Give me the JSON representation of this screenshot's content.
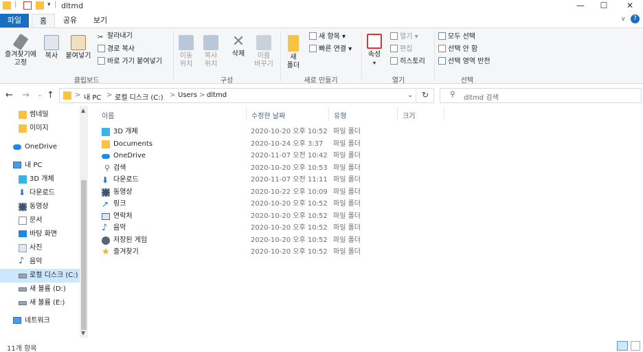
{
  "window": {
    "title": "dltmd",
    "minimize_glyph": "—",
    "maximize_glyph": "☐",
    "close_glyph": "✕"
  },
  "tabs": {
    "file": "파일",
    "home": "홈",
    "share": "공유",
    "view": "보기",
    "help_glyph": "?",
    "collapse_glyph": "∨"
  },
  "ribbon": {
    "pin": "즐겨찾기에\n고정",
    "copy": "복사",
    "paste": "붙여넣기",
    "cut": "잘라내기",
    "copy_path": "경로 복사",
    "paste_shortcut": "바로 가기 붙여넣기",
    "clipboard_group": "클립보드",
    "move_to": "이동\n위치",
    "copy_to": "복사\n위치",
    "delete": "삭제",
    "rename": "이름\n바꾸기",
    "organize_group": "구성",
    "new_folder": "새\n폴더",
    "new_item": "새 항목",
    "easy_access": "빠른 연결",
    "new_group": "새로 만들기",
    "properties": "속성",
    "open": "열기",
    "edit": "편집",
    "history": "히스토리",
    "open_group": "열기",
    "select_all": "모두 선택",
    "select_none": "선택 안 함",
    "invert_selection": "선택 영역 반전",
    "select_group": "선택"
  },
  "address": {
    "back": "←",
    "forward": "→",
    "recent": "⌄",
    "up": "↑",
    "crumbs": [
      "내 PC",
      "로컬 디스크 (C:)",
      "Users",
      "dltmd"
    ],
    "separator": ">",
    "dropdown": "⌄",
    "refresh": "↻",
    "search_placeholder": "dltmd 검색"
  },
  "sidebar": {
    "items": [
      {
        "label": "썸네일",
        "icon": "folder-icon"
      },
      {
        "label": "이미지",
        "icon": "folder-icon"
      },
      {
        "label": "OneDrive",
        "icon": "cloud-icon"
      },
      {
        "label": "내 PC",
        "icon": "pc-icon"
      },
      {
        "label": "3D 개체",
        "icon": "cube-icon"
      },
      {
        "label": "다운로드",
        "icon": "download-icon"
      },
      {
        "label": "동영상",
        "icon": "video-icon"
      },
      {
        "label": "문서",
        "icon": "document-icon"
      },
      {
        "label": "바탕 화면",
        "icon": "desktop-icon"
      },
      {
        "label": "사진",
        "icon": "picture-icon"
      },
      {
        "label": "음악",
        "icon": "music-icon"
      },
      {
        "label": "로컬 디스크 (C:)",
        "icon": "drive-icon"
      },
      {
        "label": "새 볼륨 (D:)",
        "icon": "drive-icon"
      },
      {
        "label": "새 볼륨 (E:)",
        "icon": "drive-icon"
      },
      {
        "label": "네트워크",
        "icon": "network-icon"
      }
    ]
  },
  "columns": {
    "name": "이름",
    "date": "수정한 날짜",
    "type": "유형",
    "size": "크기"
  },
  "files": [
    {
      "name": "3D 개체",
      "date": "2020-10-20 오후 10:52",
      "type": "파일 폴더",
      "icon": "cube-icon"
    },
    {
      "name": "Documents",
      "date": "2020-10-24 오후 3:37",
      "type": "파일 폴더",
      "icon": "folder-icon"
    },
    {
      "name": "OneDrive",
      "date": "2020-11-07 오전 10:42",
      "type": "파일 폴더",
      "icon": "cloud-icon"
    },
    {
      "name": "검색",
      "date": "2020-10-20 오후 10:53",
      "type": "파일 폴더",
      "icon": "search-icon"
    },
    {
      "name": "다운로드",
      "date": "2020-11-07 오전 11:11",
      "type": "파일 폴더",
      "icon": "download-icon"
    },
    {
      "name": "동영상",
      "date": "2020-10-22 오후 10:09",
      "type": "파일 폴더",
      "icon": "video-icon"
    },
    {
      "name": "링크",
      "date": "2020-10-20 오후 10:52",
      "type": "파일 폴더",
      "icon": "link-icon"
    },
    {
      "name": "연락처",
      "date": "2020-10-20 오후 10:52",
      "type": "파일 폴더",
      "icon": "contacts-icon"
    },
    {
      "name": "음악",
      "date": "2020-10-20 오후 10:52",
      "type": "파일 폴더",
      "icon": "music-icon"
    },
    {
      "name": "저장된 게임",
      "date": "2020-10-20 오후 10:52",
      "type": "파일 폴더",
      "icon": "games-icon"
    },
    {
      "name": "즐겨찾기",
      "date": "2020-10-20 오후 10:52",
      "type": "파일 폴더",
      "icon": "star-icon"
    }
  ],
  "status": {
    "count": "11개 항목"
  },
  "colors": {
    "accent": "#1a6fc0",
    "folder": "#f8c244",
    "selected": "#cce8ff"
  }
}
